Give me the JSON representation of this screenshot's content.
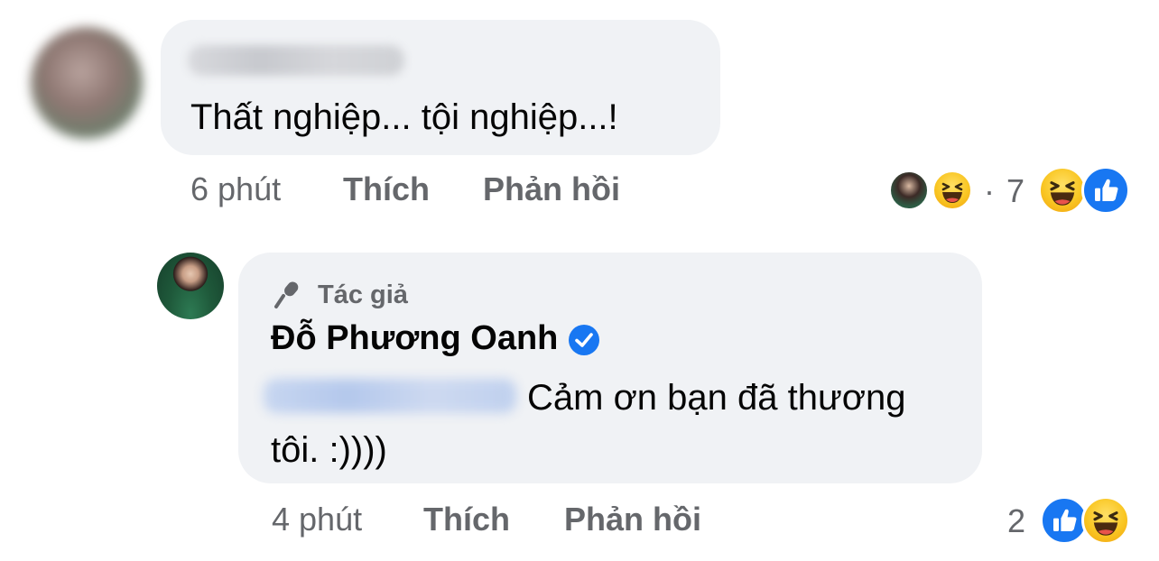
{
  "comment": {
    "text": "Thất nghiệp... tội nghiệp...!",
    "time": "6 phút",
    "like_label": "Thích",
    "reply_label": "Phản hồi",
    "reaction_count": "7",
    "reaction_separator": "·",
    "reactions": [
      "haha-icon",
      "like-icon"
    ]
  },
  "reply": {
    "author_badge": "Tác giả",
    "author_name": "Đỗ Phương Oanh",
    "text": "Cảm ơn bạn đã thương tôi. :))))",
    "time": "4 phút",
    "like_label": "Thích",
    "reply_label": "Phản hồi",
    "reaction_count": "2",
    "reactions": [
      "like-icon",
      "haha-icon"
    ]
  },
  "colors": {
    "bubble": "#f0f2f5",
    "meta_text": "#65676b",
    "like_blue": "#1877f2",
    "haha_yellow": "#f9c623"
  }
}
